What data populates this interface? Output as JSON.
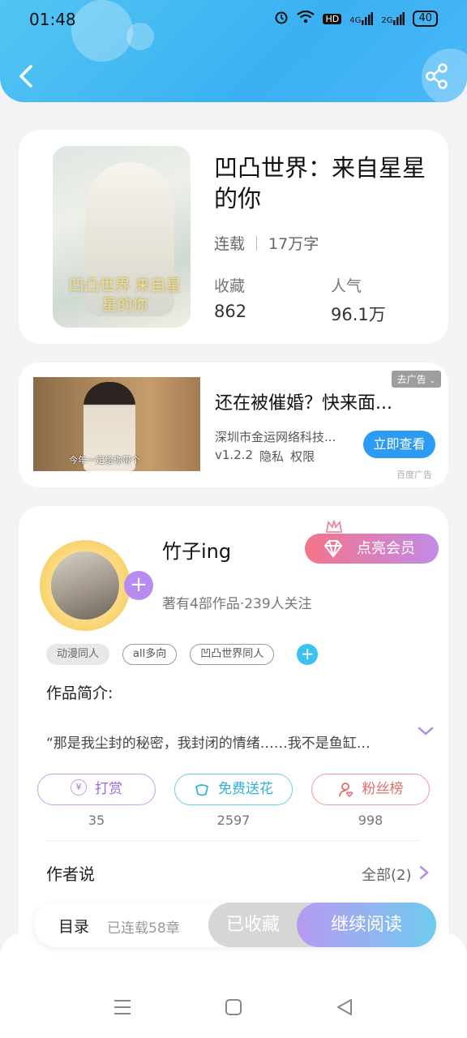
{
  "status_bar": {
    "time": "01:48",
    "signal_a": "4G",
    "signal_b": "2G",
    "hd": "HD",
    "battery": "40"
  },
  "book": {
    "title": "凹凸世界：来自星星的你",
    "status": "连载",
    "word_count": "17万字",
    "favorites_label": "收藏",
    "favorites_value": "862",
    "popularity_label": "人气",
    "popularity_value": "96.1万",
    "cover_text": "凹凸世界 来自星星的你"
  },
  "ad": {
    "title": "还在被催婚？快来面...",
    "company": "深圳市金运网络科技...",
    "version": "v1.2.2",
    "privacy": "隐私",
    "permissions": "权限",
    "cta": "立即查看",
    "skip": "去广告",
    "source": "百度广告",
    "video_caption": "今年一定给你带个"
  },
  "author": {
    "name": "竹子ing",
    "stats": "著有4部作品·239人关注",
    "vip_label": "点亮会员",
    "tags": [
      "动漫同人",
      "all多向",
      "凹凸世界同人"
    ],
    "intro_label": "作品简介:",
    "intro_text": "“那是我尘封的秘密，我封闭的情绪……我不是鱼缸…",
    "actions": [
      {
        "label": "打赏",
        "count": "35"
      },
      {
        "label": "免费送花",
        "count": "2597"
      },
      {
        "label": "粉丝榜",
        "count": "998"
      }
    ],
    "author_says": "作者说",
    "author_says_all": "全部(2)"
  },
  "bottom_bar": {
    "toc": "目录",
    "chapters": "已连载58章",
    "saved": "已收藏",
    "continue": "继续阅读"
  },
  "colors": {
    "header": "#3bb0f2",
    "accent_purple": "#b68cf0",
    "accent_blue": "#3cc2f0",
    "ad_button": "#2b9cf2"
  }
}
